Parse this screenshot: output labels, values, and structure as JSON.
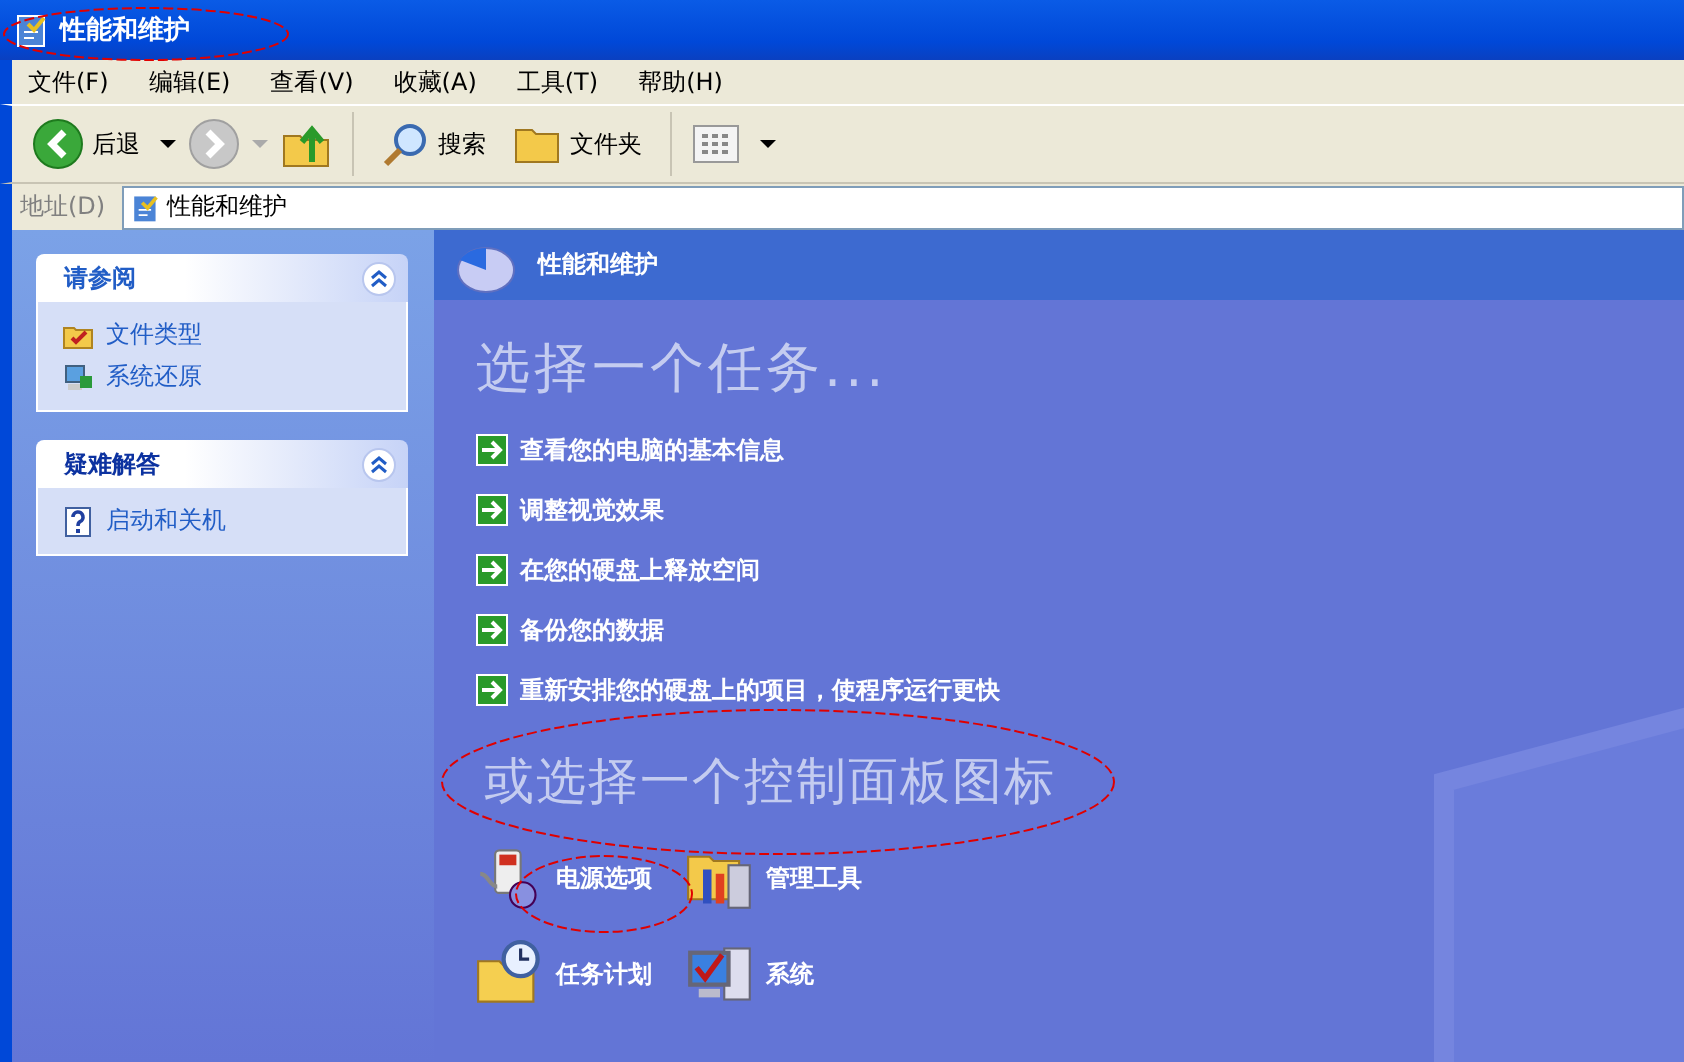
{
  "window": {
    "title": "性能和维护"
  },
  "menu": [
    "文件(F)",
    "编辑(E)",
    "查看(V)",
    "收藏(A)",
    "工具(T)",
    "帮助(H)"
  ],
  "toolbar": {
    "back": "后退",
    "search": "搜索",
    "folders": "文件夹"
  },
  "address": {
    "label": "地址(D)",
    "value": "性能和维护"
  },
  "sidebar": {
    "panels": [
      {
        "title": "请参阅",
        "expanded": true,
        "items": [
          {
            "label": "文件类型",
            "kind": "filetypes"
          },
          {
            "label": "系统还原",
            "kind": "restore"
          }
        ]
      },
      {
        "title": "疑难解答",
        "expanded": true,
        "items": [
          {
            "label": "启动和关机",
            "kind": "help"
          }
        ]
      }
    ]
  },
  "content": {
    "header": "性能和维护",
    "task_heading": "选择一个任务...",
    "tasks": [
      "查看您的电脑的基本信息",
      "调整视觉效果",
      "在您的硬盘上释放空间",
      "备份您的数据",
      "重新安排您的硬盘上的项目，使程序运行更快"
    ],
    "icon_heading": "或选择一个控制面板图标",
    "icons": [
      {
        "label": "电源选项",
        "kind": "power"
      },
      {
        "label": "管理工具",
        "kind": "admin"
      },
      {
        "label": "任务计划",
        "kind": "scheduler"
      },
      {
        "label": "系统",
        "kind": "system"
      }
    ]
  }
}
